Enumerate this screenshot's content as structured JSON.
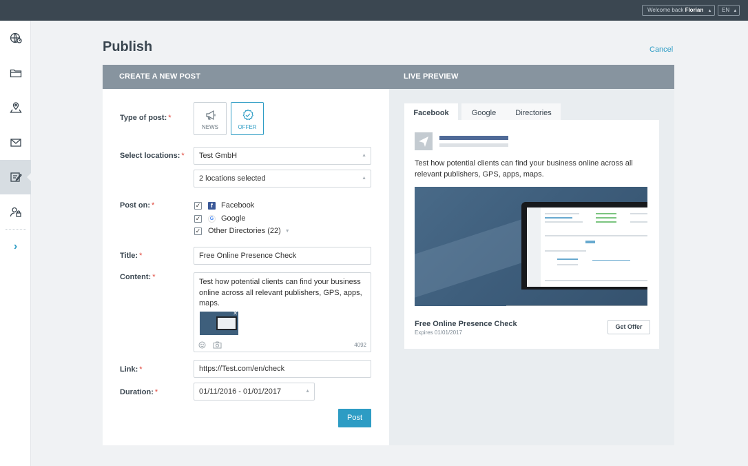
{
  "topbar": {
    "welcome_prefix": "Welcome back",
    "user_name": "Florian",
    "language": "EN"
  },
  "header": {
    "title": "Publish",
    "cancel_label": "Cancel"
  },
  "panels": {
    "create_title": "CREATE A NEW POST",
    "preview_title": "LIVE PREVIEW"
  },
  "form": {
    "type_label": "Type of post:",
    "type_options": [
      {
        "label": "NEWS",
        "icon": "megaphone-icon",
        "selected": false
      },
      {
        "label": "OFFER",
        "icon": "badge-check-icon",
        "selected": true
      }
    ],
    "locations_label": "Select locations:",
    "location_value": "Test  GmbH",
    "locations_selected": "2 locations selected",
    "post_on_label": "Post on:",
    "networks": [
      {
        "label": "Facebook",
        "checked": true
      },
      {
        "label": "Google",
        "checked": true
      },
      {
        "label": "Other Directories (22)",
        "checked": true
      }
    ],
    "title_label": "Title:",
    "title_value": "Free Online Presence Check",
    "content_label": "Content:",
    "content_value": "Test how potential clients can find your business online across all relevant publishers, GPS, apps, maps.",
    "char_count": "4092",
    "link_label": "Link:",
    "link_value": "https://Test.com/en/check",
    "duration_label": "Duration:",
    "duration_value": "01/11/2016  -  01/01/2017",
    "post_button": "Post",
    "required_mark": "*"
  },
  "preview": {
    "tabs": [
      {
        "label": "Facebook",
        "active": true
      },
      {
        "label": "Google",
        "active": false
      },
      {
        "label": "Directories",
        "active": false
      }
    ],
    "text": "Test how potential clients can find your business online across all relevant publishers, GPS, apps, maps.",
    "title": "Free Online Presence Check",
    "expires": "Expires 01/01/2017",
    "cta_label": "Get Offer"
  },
  "colors": {
    "accent": "#2d9cc4",
    "topbar": "#3b4751",
    "panel_header": "#87949f",
    "required": "#e0463b"
  }
}
